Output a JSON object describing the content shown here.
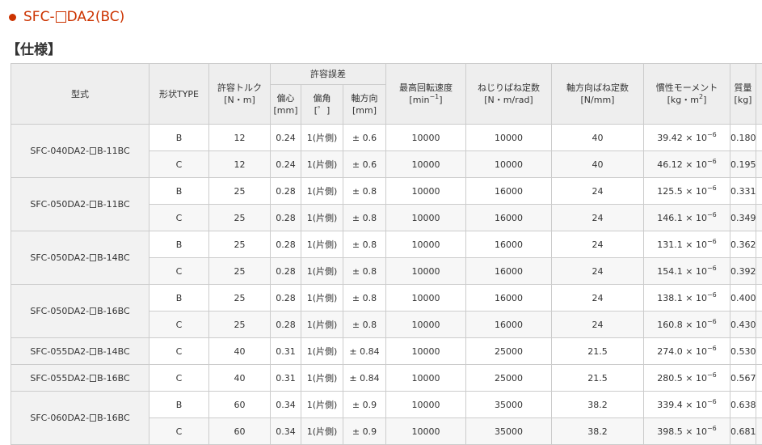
{
  "product": {
    "title_prefix": "SFC-",
    "title_suffix": "DA2(BC)"
  },
  "section": {
    "heading": "【仕様】"
  },
  "table": {
    "headers": {
      "model": "型式",
      "shape": "形状TYPE",
      "torque_label": "許容トルク",
      "torque_unit": "[N・m]",
      "misalignment": "許容誤差",
      "parallel_label": "偏心",
      "parallel_unit": "[mm]",
      "angular_label": "偏角",
      "angular_unit": "[゜]",
      "axial_label": "軸方向",
      "axial_unit": "[mm]",
      "speed_label": "最高回転速度",
      "speed_unit_base": "[min",
      "speed_unit_exp": "−1",
      "speed_unit_close": "]",
      "torsional_label": "ねじりばね定数",
      "torsional_unit": "[N・m/rad]",
      "axial_spring_label": "軸方向ばね定数",
      "axial_spring_unit": "[N/mm]",
      "inertia_label": "慣性モーメント",
      "inertia_unit_base": "[kg・m",
      "inertia_unit_exp": "2",
      "inertia_unit_close": "]",
      "mass_label": "質量",
      "mass_unit": "[kg]"
    },
    "exp_text": "−6",
    "groups": [
      {
        "model_prefix": "SFC-040DA2-",
        "model_suffix": "B-11BC",
        "rows": [
          {
            "type": "B",
            "torque": "12",
            "parallel": "0.24",
            "angular": "1(片側)",
            "axial": "± 0.6",
            "speed": "10000",
            "torsional": "10000",
            "axial_spring": "40",
            "inertia_base": "39.42 × 10",
            "mass": "0.180"
          },
          {
            "type": "C",
            "torque": "12",
            "parallel": "0.24",
            "angular": "1(片側)",
            "axial": "± 0.6",
            "speed": "10000",
            "torsional": "10000",
            "axial_spring": "40",
            "inertia_base": "46.12 × 10",
            "mass": "0.195"
          }
        ]
      },
      {
        "model_prefix": "SFC-050DA2-",
        "model_suffix": "B-11BC",
        "rows": [
          {
            "type": "B",
            "torque": "25",
            "parallel": "0.28",
            "angular": "1(片側)",
            "axial": "± 0.8",
            "speed": "10000",
            "torsional": "16000",
            "axial_spring": "24",
            "inertia_base": "125.5 × 10",
            "mass": "0.331"
          },
          {
            "type": "C",
            "torque": "25",
            "parallel": "0.28",
            "angular": "1(片側)",
            "axial": "± 0.8",
            "speed": "10000",
            "torsional": "16000",
            "axial_spring": "24",
            "inertia_base": "146.1 × 10",
            "mass": "0.349"
          }
        ]
      },
      {
        "model_prefix": "SFC-050DA2-",
        "model_suffix": "B-14BC",
        "rows": [
          {
            "type": "B",
            "torque": "25",
            "parallel": "0.28",
            "angular": "1(片側)",
            "axial": "± 0.8",
            "speed": "10000",
            "torsional": "16000",
            "axial_spring": "24",
            "inertia_base": "131.1 × 10",
            "mass": "0.362"
          },
          {
            "type": "C",
            "torque": "25",
            "parallel": "0.28",
            "angular": "1(片側)",
            "axial": "± 0.8",
            "speed": "10000",
            "torsional": "16000",
            "axial_spring": "24",
            "inertia_base": "154.1 × 10",
            "mass": "0.392"
          }
        ]
      },
      {
        "model_prefix": "SFC-050DA2-",
        "model_suffix": "B-16BC",
        "rows": [
          {
            "type": "B",
            "torque": "25",
            "parallel": "0.28",
            "angular": "1(片側)",
            "axial": "± 0.8",
            "speed": "10000",
            "torsional": "16000",
            "axial_spring": "24",
            "inertia_base": "138.1 × 10",
            "mass": "0.400"
          },
          {
            "type": "C",
            "torque": "25",
            "parallel": "0.28",
            "angular": "1(片側)",
            "axial": "± 0.8",
            "speed": "10000",
            "torsional": "16000",
            "axial_spring": "24",
            "inertia_base": "160.8 × 10",
            "mass": "0.430"
          }
        ]
      },
      {
        "model_prefix": "SFC-055DA2-",
        "model_suffix": "B-14BC",
        "rows": [
          {
            "type": "C",
            "torque": "40",
            "parallel": "0.31",
            "angular": "1(片側)",
            "axial": "± 0.84",
            "speed": "10000",
            "torsional": "25000",
            "axial_spring": "21.5",
            "inertia_base": "274.0 × 10",
            "mass": "0.530"
          }
        ]
      },
      {
        "model_prefix": "SFC-055DA2-",
        "model_suffix": "B-16BC",
        "rows": [
          {
            "type": "C",
            "torque": "40",
            "parallel": "0.31",
            "angular": "1(片側)",
            "axial": "± 0.84",
            "speed": "10000",
            "torsional": "25000",
            "axial_spring": "21.5",
            "inertia_base": "280.5 × 10",
            "mass": "0.567"
          }
        ]
      },
      {
        "model_prefix": "SFC-060DA2-",
        "model_suffix": "B-16BC",
        "rows": [
          {
            "type": "B",
            "torque": "60",
            "parallel": "0.34",
            "angular": "1(片側)",
            "axial": "± 0.9",
            "speed": "10000",
            "torsional": "35000",
            "axial_spring": "38.2",
            "inertia_base": "339.4 × 10",
            "mass": "0.638"
          },
          {
            "type": "C",
            "torque": "60",
            "parallel": "0.34",
            "angular": "1(片側)",
            "axial": "± 0.9",
            "speed": "10000",
            "torsional": "35000",
            "axial_spring": "38.2",
            "inertia_base": "398.5 × 10",
            "mass": "0.681"
          }
        ]
      }
    ]
  }
}
